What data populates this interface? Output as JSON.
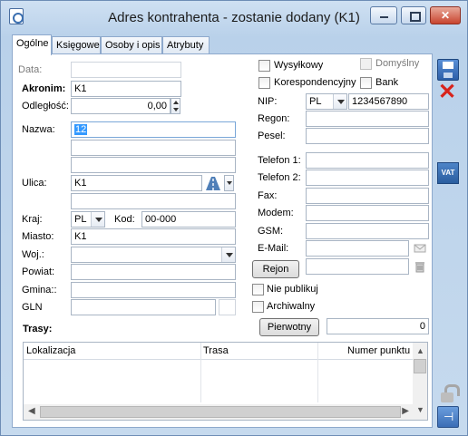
{
  "window": {
    "title": "Adres kontrahenta - zostanie dodany (K1)"
  },
  "tabs": [
    "Ogólne",
    "Księgowe",
    "Osoby i opis",
    "Atrybuty"
  ],
  "left": {
    "data_label": "Data:",
    "data_value": "",
    "akronim_label": "Akronim:",
    "akronim_value": "K1",
    "odleglosc_label": "Odległość:",
    "odleglosc_value": "0,00",
    "nazwa_label": "Nazwa:",
    "nazwa_line1": "12",
    "nazwa_line2": "",
    "nazwa_line3": "",
    "ulica_label": "Ulica:",
    "ulica_line1": "K1",
    "ulica_line2": "",
    "kraj_label": "Kraj:",
    "kraj_value": "PL",
    "kod_label": "Kod:",
    "kod_value": "00-000",
    "miasto_label": "Miasto:",
    "miasto_value": "K1",
    "woj_label": "Woj.:",
    "woj_value": "",
    "powiat_label": "Powiat:",
    "powiat_value": "",
    "gmina_label": "Gmina::",
    "gmina_value": "",
    "gln_label": "GLN",
    "gln_value": ""
  },
  "right": {
    "wysylkowy_label": "Wysyłkowy",
    "domyslny_label": "Domyślny",
    "korespondencyjny_label": "Korespondencyjny",
    "bank_label": "Bank",
    "nip_label": "NIP:",
    "nip_prefix": "PL",
    "nip_value": "1234567890",
    "regon_label": "Regon:",
    "pesel_label": "Pesel:",
    "telefon1_label": "Telefon 1:",
    "telefon2_label": "Telefon 2:",
    "fax_label": "Fax:",
    "modem_label": "Modem:",
    "gsm_label": "GSM:",
    "email_label": "E-Mail:",
    "rejon_button": "Rejon",
    "nie_publikuj_label": "Nie publikuj",
    "archiwalny_label": "Archiwalny",
    "pierwotny_button": "Pierwotny",
    "pierwotny_value": "0"
  },
  "trasy": {
    "label": "Trasy:",
    "columns": [
      "Lokalizacja",
      "Trasa",
      "Numer punktu"
    ]
  },
  "icons": {
    "save": "save-icon",
    "close": "close-icon",
    "vat": "vat-icon",
    "lock": "lock-icon",
    "pin": "pin-icon"
  },
  "vat_text": "VAT"
}
